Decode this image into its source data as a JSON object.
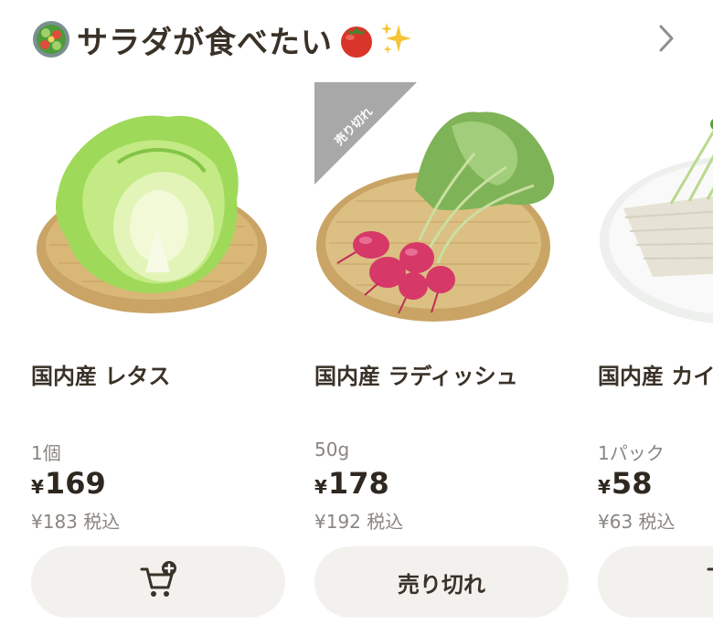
{
  "section": {
    "title": "サラダが食べたい",
    "leading_icon": "salad-bowl-icon",
    "trailing_icons": [
      "tomato-icon",
      "sparkles-icon"
    ],
    "more_icon": "chevron-right-icon"
  },
  "products": [
    {
      "name": "国内産 レタス",
      "unit": "1個",
      "price_currency": "¥",
      "price": "169",
      "tax_price": "¥183 税込",
      "sold_out": false,
      "button_icon": "add-to-cart-icon"
    },
    {
      "name": "国内産 ラディッシュ",
      "unit": "50g",
      "price_currency": "¥",
      "price": "178",
      "tax_price": "¥192 税込",
      "sold_out": true,
      "ribbon_label": "売り切れ",
      "button_label": "売り切れ"
    },
    {
      "name": "国内産 カイ",
      "unit": "1パック",
      "price_currency": "¥",
      "price": "58",
      "tax_price": "¥63 税込",
      "sold_out": false,
      "button_icon": "add-to-cart-icon"
    }
  ],
  "colors": {
    "text": "#3a3228",
    "muted": "#8a8580",
    "button_bg": "#f2f1ee",
    "ribbon": "#a8a8a8"
  }
}
